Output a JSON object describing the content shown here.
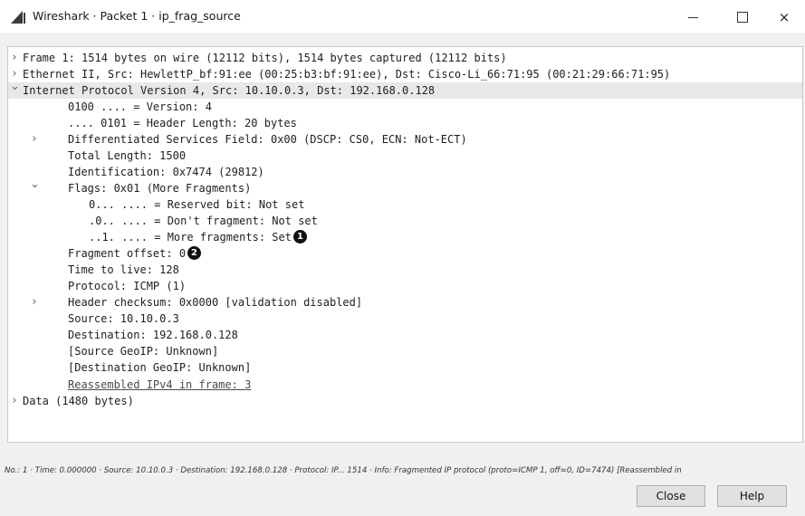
{
  "window": {
    "title": "Wireshark · Packet 1 · ip_frag_source",
    "controls": {
      "minimize": "",
      "maximize": "",
      "close": "×"
    }
  },
  "tree": [
    {
      "text": "Frame 1: 1514 bytes on wire (12112 bits), 1514 bytes captured (12112 bits)",
      "indent": 0,
      "arrow": "collapsed"
    },
    {
      "text": "Ethernet II, Src: HewlettP_bf:91:ee (00:25:b3:bf:91:ee), Dst: Cisco-Li_66:71:95 (00:21:29:66:71:95)",
      "indent": 0,
      "arrow": "collapsed"
    },
    {
      "text": "Internet Protocol Version 4, Src: 10.10.0.3, Dst: 192.168.0.128",
      "indent": 0,
      "arrow": "expanded",
      "selected": true
    },
    {
      "text": "0100 .... = Version: 4",
      "indent": 1,
      "arrow": "none"
    },
    {
      "text": ".... 0101 = Header Length: 20 bytes",
      "indent": 1,
      "arrow": "none"
    },
    {
      "text": "Differentiated Services Field: 0x00 (DSCP: CS0, ECN: Not-ECT)",
      "indent": 1,
      "arrow": "collapsed"
    },
    {
      "text": "Total Length: 1500",
      "indent": 1,
      "arrow": "none"
    },
    {
      "text": "Identification: 0x7474 (29812)",
      "indent": 1,
      "arrow": "none"
    },
    {
      "text": "Flags: 0x01 (More Fragments)",
      "indent": 1,
      "arrow": "expanded"
    },
    {
      "text": "0... .... = Reserved bit: Not set",
      "indent": 2,
      "arrow": "none"
    },
    {
      "text": ".0.. .... = Don't fragment: Not set",
      "indent": 2,
      "arrow": "none"
    },
    {
      "text": "..1. .... = More fragments: Set",
      "indent": 2,
      "arrow": "none",
      "callout": "1"
    },
    {
      "text": "Fragment offset: 0",
      "indent": 1,
      "arrow": "none",
      "callout": "2"
    },
    {
      "text": "Time to live: 128",
      "indent": 1,
      "arrow": "none"
    },
    {
      "text": "Protocol: ICMP (1)",
      "indent": 1,
      "arrow": "none"
    },
    {
      "text": "Header checksum: 0x0000 [validation disabled]",
      "indent": 1,
      "arrow": "collapsed"
    },
    {
      "text": "Source: 10.10.0.3",
      "indent": 1,
      "arrow": "none"
    },
    {
      "text": "Destination: 192.168.0.128",
      "indent": 1,
      "arrow": "none"
    },
    {
      "text": "[Source GeoIP: Unknown]",
      "indent": 1,
      "arrow": "none"
    },
    {
      "text": "[Destination GeoIP: Unknown]",
      "indent": 1,
      "arrow": "none"
    },
    {
      "text": "Reassembled IPv4 in frame: 3",
      "indent": 1,
      "arrow": "none",
      "link": true
    },
    {
      "text": "Data (1480 bytes)",
      "indent": 0,
      "arrow": "collapsed"
    }
  ],
  "status_bar": "No.: 1 · Time: 0.000000 · Source: 10.10.0.3 · Destination: 192.168.0.128 · Protocol: IP... 1514 · Info: Fragmented IP protocol (proto=ICMP 1, off=0, ID=7474) [Reassembled in",
  "buttons": {
    "close": "Close",
    "help": "Help"
  },
  "colors": {
    "selected_row": "#e8e8e8",
    "tree_background": "#ffffff",
    "dialog_background": "#f0f0f0"
  },
  "icons": {
    "app": "wireshark-fin-icon",
    "expanded": "chevron-down-icon",
    "collapsed": "chevron-right-icon"
  }
}
